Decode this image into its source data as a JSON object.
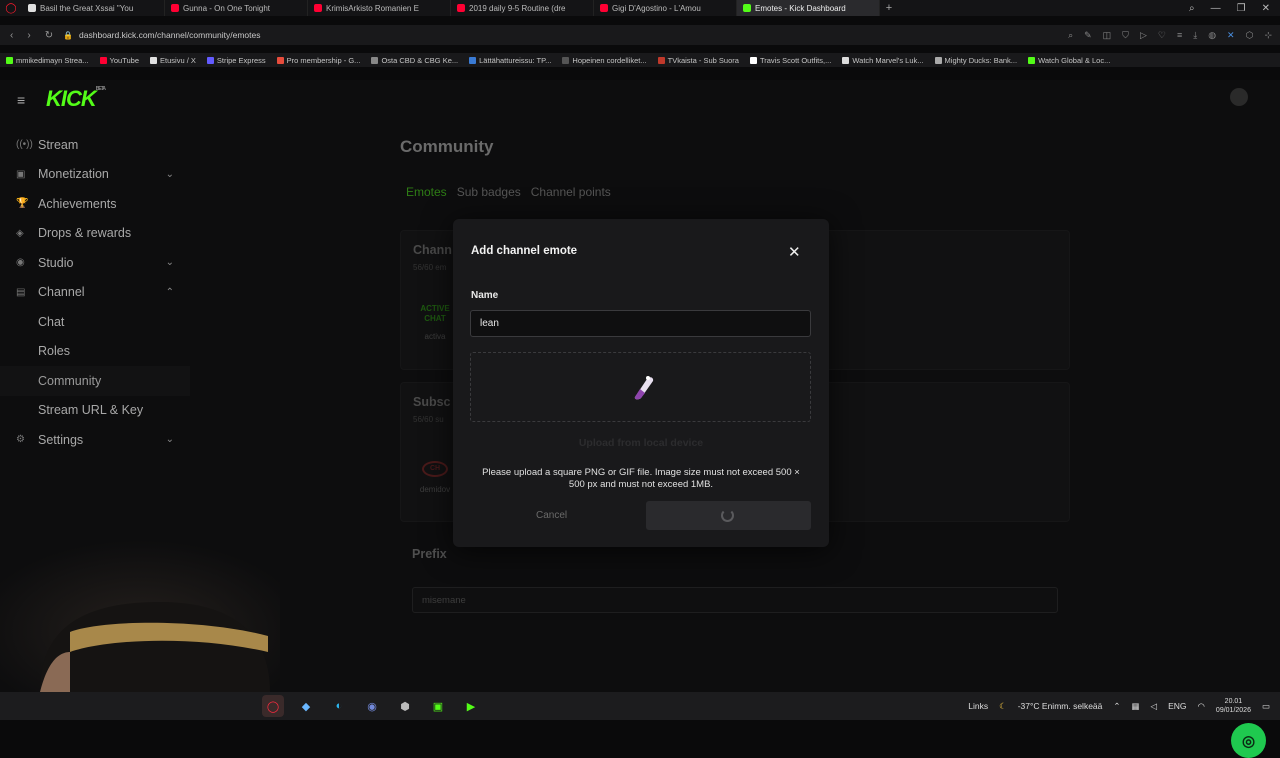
{
  "browser": {
    "tabs": [
      {
        "title": "Basil the Great Xssai \"You",
        "color": "#e0e0e0",
        "active": false
      },
      {
        "title": "Gunna - On One Tonight",
        "color": "#ff0033",
        "active": false
      },
      {
        "title": "KrimisArkisto Romanien E",
        "color": "#ff0033",
        "active": false
      },
      {
        "title": "2019 daily 9-5 Routine (dre",
        "color": "#ff0033",
        "active": false
      },
      {
        "title": "Gigi D'Agostino - L'Amou",
        "color": "#ff0033",
        "active": false
      },
      {
        "title": "Emotes - Kick Dashboard",
        "color": "#53fc18",
        "active": true
      }
    ],
    "url": "dashboard.kick.com/channel/community/emotes",
    "bookmarks": [
      {
        "label": "mmikedimayn Strea...",
        "color": "#53fc18"
      },
      {
        "label": "YouTube",
        "color": "#ff0033"
      },
      {
        "label": "Etusivu / X",
        "color": "#e0e0e0"
      },
      {
        "label": "Stripe Express",
        "color": "#635bff"
      },
      {
        "label": "Pro membership - G...",
        "color": "#e74c3c"
      },
      {
        "label": "Osta CBD & CBG Ke...",
        "color": "#888888"
      },
      {
        "label": "Lättähattureissu: TP...",
        "color": "#3a7bd5"
      },
      {
        "label": "Hopeinen cordelliket...",
        "color": "#555555"
      },
      {
        "label": "TVkaista - Sub Suora",
        "color": "#c0392b"
      },
      {
        "label": "Travis Scott Outfits,...",
        "color": "#ffffff"
      },
      {
        "label": "Watch Marvel's Luk...",
        "color": "#dddddd"
      },
      {
        "label": "Mighty Ducks: Bank...",
        "color": "#aaaaaa"
      },
      {
        "label": "Watch Global & Loc...",
        "color": "#53fc18"
      }
    ]
  },
  "app": {
    "logo": "KICK",
    "logo_sup": "BETA",
    "sidebar": [
      {
        "label": "Stream",
        "icon": "((•))",
        "chevron": ""
      },
      {
        "label": "Monetization",
        "icon": "▣",
        "chevron": "⌄"
      },
      {
        "label": "Achievements",
        "icon": "🏆",
        "chevron": ""
      },
      {
        "label": "Drops & rewards",
        "icon": "◈",
        "chevron": ""
      },
      {
        "label": "Studio",
        "icon": "◉",
        "chevron": "⌄"
      },
      {
        "label": "Channel",
        "icon": "▤",
        "chevron": "⌃"
      },
      {
        "label": "Chat",
        "icon": "",
        "chevron": "",
        "sub": true
      },
      {
        "label": "Roles",
        "icon": "",
        "chevron": "",
        "sub": true
      },
      {
        "label": "Community",
        "icon": "",
        "chevron": "",
        "sub": true,
        "selected": true
      },
      {
        "label": "Stream URL & Key",
        "icon": "",
        "chevron": "",
        "sub": true
      },
      {
        "label": "Settings",
        "icon": "⚙",
        "chevron": "⌄"
      }
    ],
    "page_title": "Community",
    "subtabs": [
      "Emotes",
      "Sub badges",
      "Channel points"
    ],
    "channel_card": {
      "title": "Chann",
      "count": "56/60 em",
      "emote_name": "activa",
      "emote_text1": "ACTIVE",
      "emote_text2": "CHAT"
    },
    "sub_card": {
      "title": "Subsc",
      "count": "56/60 su",
      "emote_name": "demidov"
    },
    "prefix": {
      "title": "Prefix",
      "value": "misemane"
    }
  },
  "modal": {
    "title": "Add channel emote",
    "name_label": "Name",
    "name_value": "lean",
    "upload_label": "Upload from local device",
    "hint": "Please upload a square PNG or GIF file. Image size must not exceed 500 × 500 px and must not exceed 1MB.",
    "cancel_label": "Cancel"
  },
  "taskbar": {
    "links_label": "Links",
    "weather": "-37°C Enimm. selkeää",
    "lang": "ENG",
    "time": "20.01",
    "date": "09/01/2026"
  }
}
